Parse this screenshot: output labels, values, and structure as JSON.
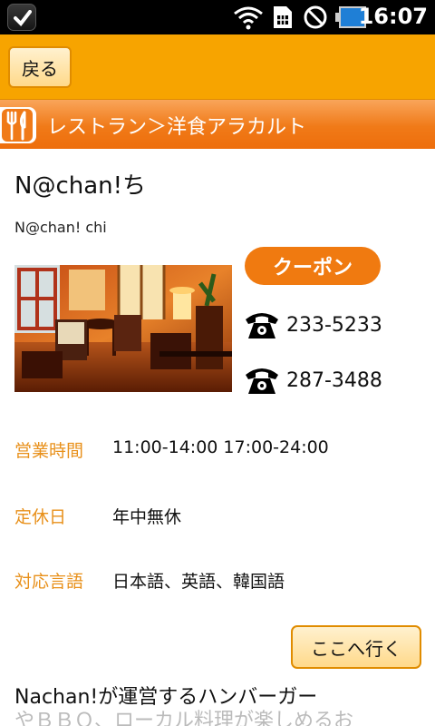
{
  "status_bar": {
    "time": "16:07",
    "icons": [
      "app-notification-icon",
      "wifi-icon",
      "sim-icon",
      "no-signal-icon",
      "battery-icon"
    ]
  },
  "topbar": {
    "back_label": "戻る"
  },
  "category": {
    "icon": "fork-knife-icon",
    "breadcrumb": "レストラン＞洋食アラカルト"
  },
  "restaurant": {
    "name": "N@chan!ち",
    "name_romaji": "N@chan! chi",
    "photo": "restaurant-interior-photo",
    "coupon_label": "クーポン",
    "phones": [
      "233-5233",
      "287-3488"
    ],
    "info": [
      {
        "label": "営業時間",
        "value": "11:00-14:00 17:00-24:00"
      },
      {
        "label": "定休日",
        "value": "年中無休"
      },
      {
        "label": "対応言語",
        "value": "日本語、英語、韓国語"
      }
    ],
    "go_label": "ここへ行く",
    "description_line1": "Nachan!が運営するハンバーガー",
    "description_line2": "やＢＢＱ、ローカル料理が楽しめるお"
  },
  "colors": {
    "topbar": "#f7a400",
    "category_bar": "#f07a18",
    "label_orange": "#e8901a",
    "coupon": "#f07a10"
  }
}
